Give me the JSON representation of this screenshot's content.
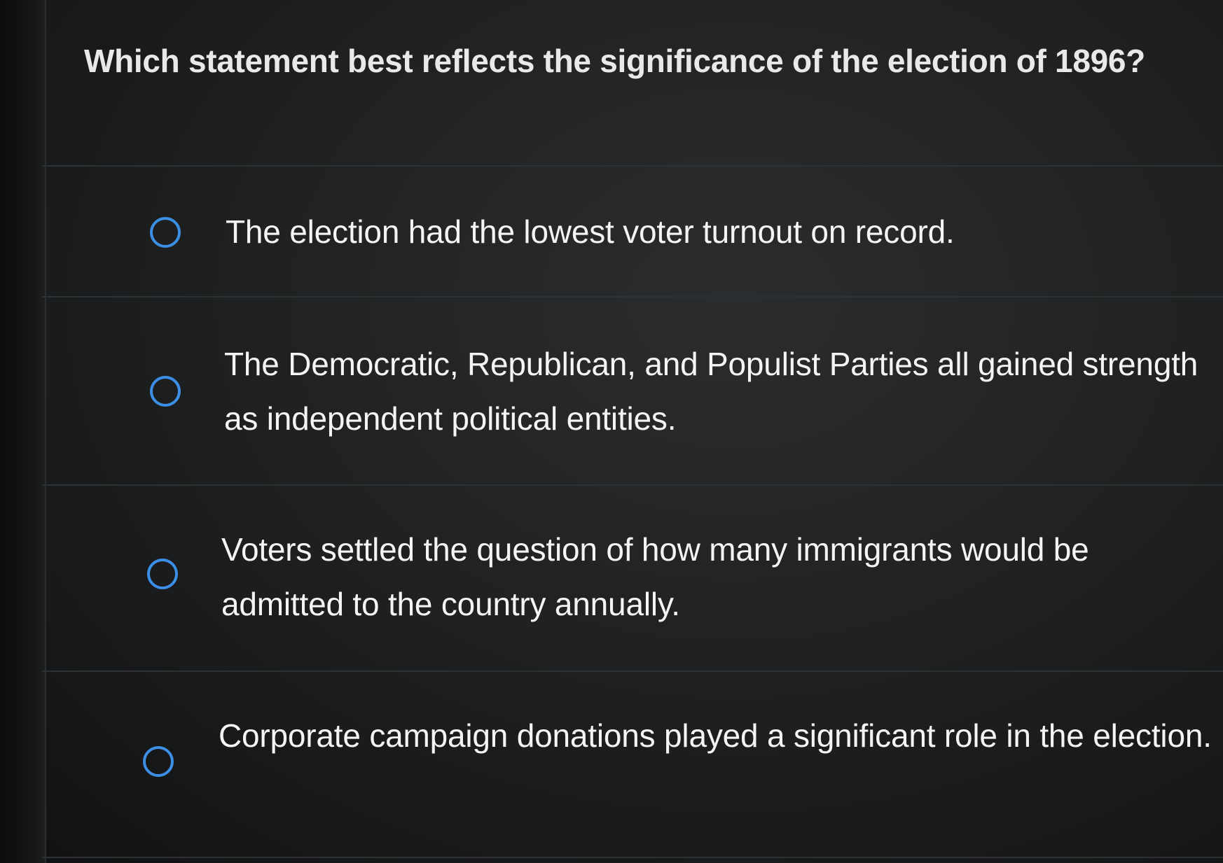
{
  "question": {
    "text": "Which statement best reflects the significance of the election of 1896?"
  },
  "options": [
    {
      "label": "The election had the lowest voter turnout on record.",
      "selected": false
    },
    {
      "label": "The Democratic, Republican, and Populist Parties all gained strength as independent political entities.",
      "selected": false
    },
    {
      "label": "Voters settled the question of how many immigrants would be admitted to the country annually.",
      "selected": false
    },
    {
      "label": "Corporate campaign donations played a significant role in the election.",
      "selected": false
    }
  ],
  "colors": {
    "background": "#1f2122",
    "radio_border": "#3d8fe6",
    "text": "#f4f4f4",
    "divider": "#2e3133"
  }
}
